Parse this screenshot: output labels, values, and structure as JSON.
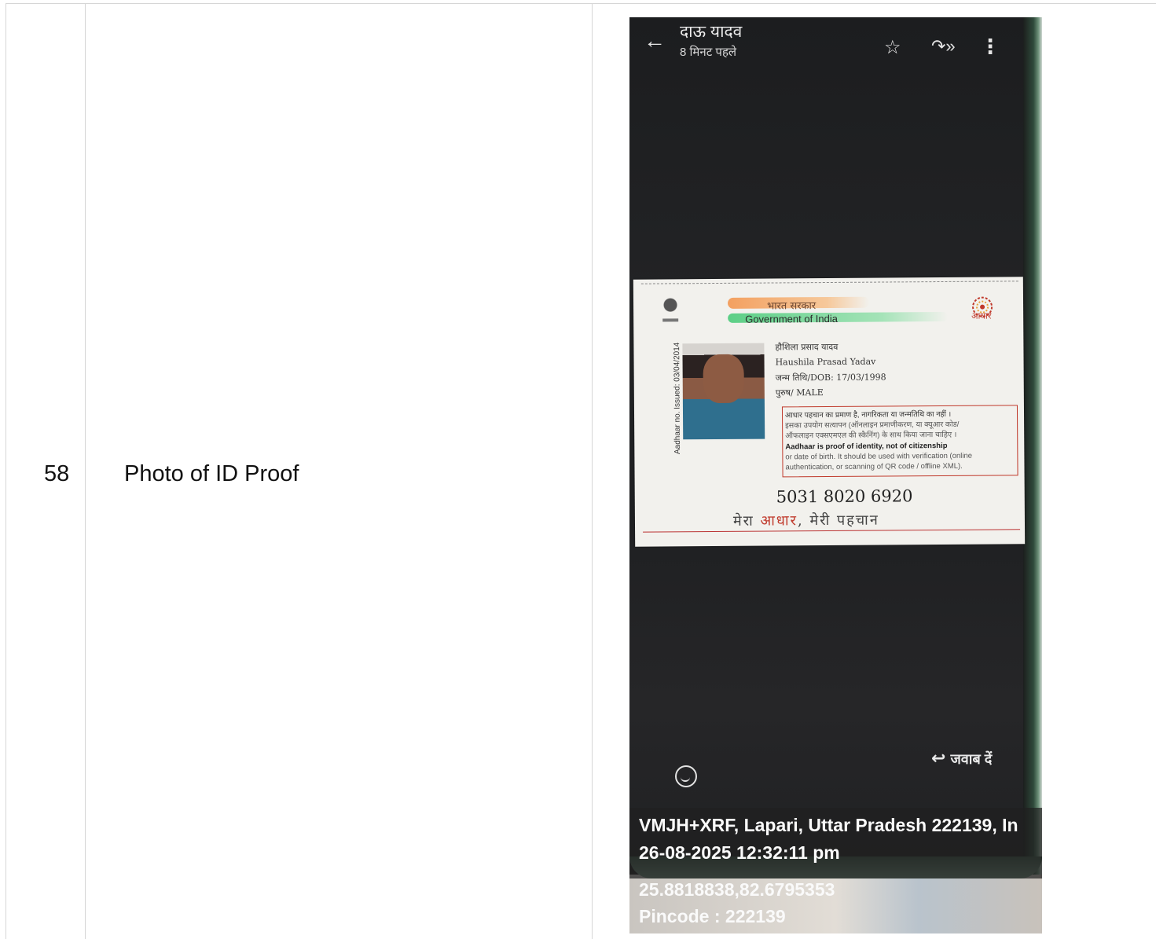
{
  "row": {
    "number": "58",
    "label": "Photo of ID Proof"
  },
  "screen": {
    "contact_name": "दाऊ यादव",
    "time_ago": "8 मिनट पहले",
    "reply_label": "जवाब दें",
    "icons": [
      "back-arrow-icon",
      "star-icon",
      "forward-icon",
      "more-vert-icon",
      "emoji-add-icon",
      "reply-icon"
    ]
  },
  "id_card": {
    "govt_hindi": "भारत सरकार",
    "govt_english": "Government of India",
    "logo_text": "आधार",
    "issued": "Aadhaar no. Issued: 03/04/2014",
    "name_hindi": "हौशिला प्रसाद यादव",
    "name_english": "Haushila Prasad Yadav",
    "dob": "जन्म तिथि/DOB: 17/03/1998",
    "gender": "पुरुष/ MALE",
    "disclaimer_hi_1": "आधार पहचान का प्रमाण है, नागरिकता या जन्मतिथि का नहीं ।",
    "disclaimer_hi_2": "इसका उपयोग सत्यापन (ऑनलाइन प्रमाणीकरण, या क्यूआर कोड/",
    "disclaimer_hi_3": "ऑफलाइन एक्सएमएल की स्कैनिंग) के साथ किया जाना चाहिए ।",
    "disclaimer_en_1": "Aadhaar is proof of identity, not of citizenship",
    "disclaimer_en_2": "or date of birth. It should be used with verification (online",
    "disclaimer_en_3": "authentication, or scanning of QR code / offline XML).",
    "number": "5031 8020 6920",
    "tagline_part1": "मेरा ",
    "tagline_part2": "आधार",
    "tagline_part3": ", मेरी पहचान"
  },
  "geo_stamp": {
    "address": "VMJH+XRF, Lapari, Uttar Pradesh 222139, In",
    "datetime": "26-08-2025 12:32:11 pm",
    "coordinates": "25.8818838,82.6795353",
    "pincode": "Pincode : 222139"
  }
}
